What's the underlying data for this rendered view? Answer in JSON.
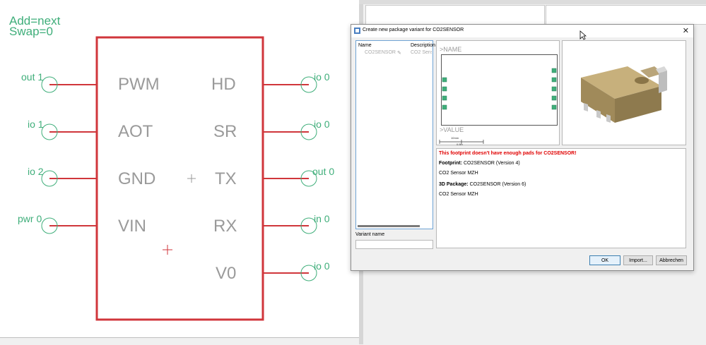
{
  "schematic": {
    "add_label": "Add=next",
    "swap_label": "Swap=0",
    "left_pins": [
      {
        "label": "out 1",
        "name": "PWM"
      },
      {
        "label": "io 1",
        "name": "AOT"
      },
      {
        "label": "io 2",
        "name": "GND"
      },
      {
        "label": "pwr 0",
        "name": "VIN"
      }
    ],
    "right_pins": [
      {
        "label": "io 0",
        "name": "HD"
      },
      {
        "label": "io 0",
        "name": "SR"
      },
      {
        "label": "out 0",
        "name": "TX"
      },
      {
        "label": "in 0",
        "name": "RX"
      },
      {
        "label": "io 0",
        "name": "V0"
      }
    ],
    "colors": {
      "body": "#d0363b",
      "pin_text": "#3fae7a",
      "pin_name": "#9a9a9a"
    }
  },
  "dialog": {
    "title": "Create new package variant for CO2SENSOR",
    "close_glyph": "✕",
    "list": {
      "col_name": "Name",
      "col_description": "Description",
      "rows": [
        {
          "name": "CO2SENSOR",
          "description": "CO2 Sens"
        }
      ]
    },
    "variant_name_label": "Variant name",
    "variant_name_value": "",
    "footprint_preview": {
      "name_text": ">NAME",
      "value_text": ">VALUE",
      "scale_top": "10mm",
      "scale_bottom": "0.5in"
    },
    "info": {
      "warning": "This footprint doesn't have enough pads for CO2SENSOR!",
      "footprint_label": "Footprint:",
      "footprint_value": "CO2SENSOR (Version 4)",
      "footprint_desc": "CO2 Sensor MZH",
      "package_label": "3D Package:",
      "package_value": "CO2SENSOR (Version 6)",
      "package_desc": "CO2 Sensor MZH"
    },
    "buttons": {
      "ok": "OK",
      "import": "Import...",
      "cancel": "Abbrechen"
    }
  }
}
